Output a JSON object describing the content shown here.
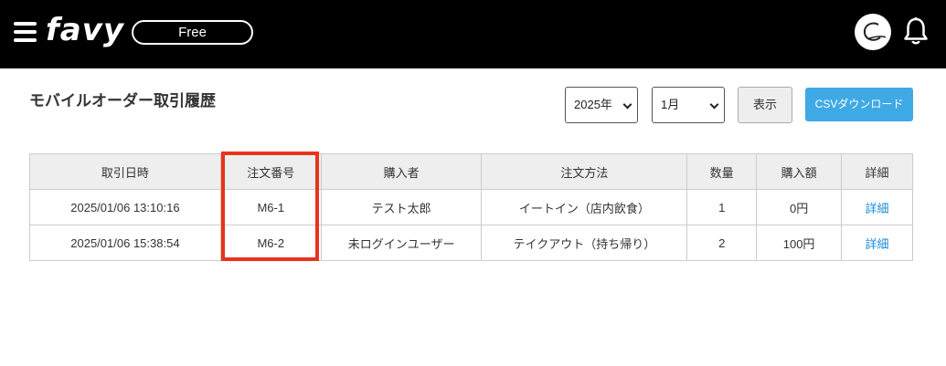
{
  "header": {
    "logo_text": "favy",
    "plan_label": "Free"
  },
  "page": {
    "title": "モバイルオーダー取引履歴"
  },
  "filters": {
    "year_value": "2025年",
    "month_value": "1月",
    "show_label": "表示",
    "csv_label": "CSVダウンロード"
  },
  "table": {
    "headers": [
      "取引日時",
      "注文番号",
      "購入者",
      "注文方法",
      "数量",
      "購入額",
      "詳細"
    ],
    "rows": [
      [
        "2025/01/06 13:10:16",
        "M6-1",
        "テスト太郎",
        "イートイン（店内飲食）",
        "1",
        "0円",
        "詳細"
      ],
      [
        "2025/01/06 15:38:54",
        "M6-2",
        "未ログインユーザー",
        "テイクアウト（持ち帰り）",
        "2",
        "100円",
        "詳細"
      ]
    ]
  },
  "colors": {
    "header_bg": "#000000",
    "csv_button": "#3fa9e5",
    "highlight": "#e8331c",
    "link": "#1a8ad8"
  }
}
